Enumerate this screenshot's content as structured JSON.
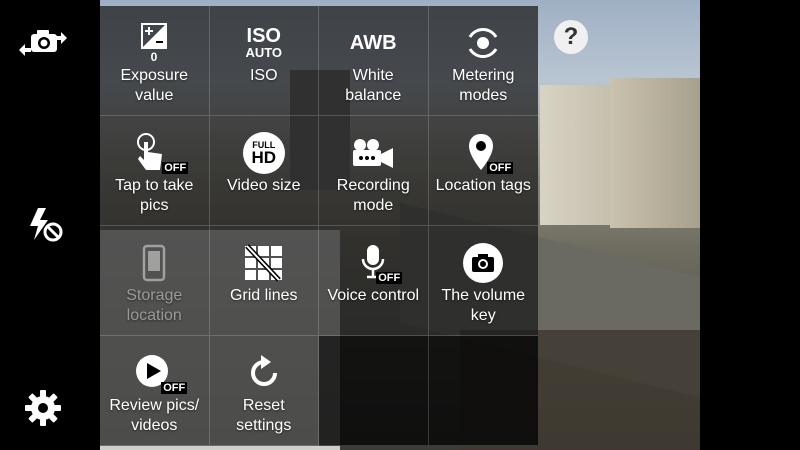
{
  "left_bar": {
    "switch_camera_icon": "camera-switch-icon",
    "flash_icon": "flash-off-icon",
    "settings_icon": "gear-icon"
  },
  "help": {
    "label": "?"
  },
  "settings_grid": [
    {
      "label": "Exposure\nvalue",
      "icon": "exposure-icon",
      "icon_value": "0"
    },
    {
      "label": "ISO",
      "icon": "iso-icon",
      "icon_text": "ISO",
      "icon_sub": "AUTO"
    },
    {
      "label": "White\nbalance",
      "icon": "awb-icon",
      "icon_text": "AWB"
    },
    {
      "label": "Metering\nmodes",
      "icon": "metering-icon"
    },
    {
      "label": "Tap to take\npics",
      "icon": "tap-icon",
      "badge": "OFF"
    },
    {
      "label": "Video size",
      "icon": "full-hd-icon",
      "icon_text": "FULL",
      "icon_sub": "HD"
    },
    {
      "label": "Recording\nmode",
      "icon": "recording-mode-icon"
    },
    {
      "label": "Location tags",
      "icon": "location-icon",
      "badge": "OFF"
    },
    {
      "label": "Storage\nlocation",
      "icon": "storage-icon",
      "disabled": true
    },
    {
      "label": "Grid lines",
      "icon": "grid-lines-icon"
    },
    {
      "label": "Voice control",
      "icon": "microphone-icon",
      "badge": "OFF"
    },
    {
      "label": "The volume\nkey",
      "icon": "camera-icon"
    },
    {
      "label": "Review pics/\nvideos",
      "icon": "review-icon",
      "badge": "OFF"
    },
    {
      "label": "Reset\nsettings",
      "icon": "reset-icon"
    }
  ]
}
